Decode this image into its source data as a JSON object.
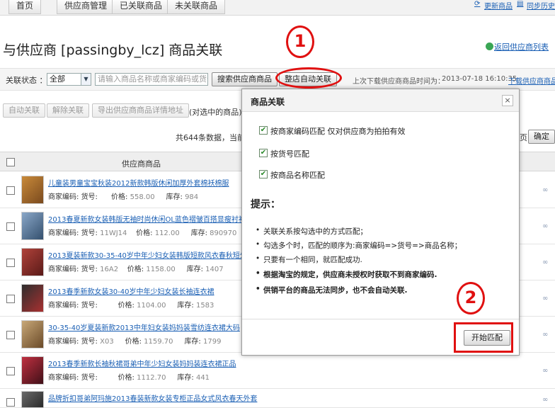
{
  "nav": {
    "tabs": [
      "首页",
      "供应商管理",
      "已关联商品",
      "未关联商品"
    ],
    "right_links": [
      "更新商品",
      "同步历史"
    ]
  },
  "page": {
    "title": "与供应商 [passingby_lcz] 商品关联",
    "back_link": "返回供应商列表"
  },
  "filter": {
    "status_label": "关联状态 ：",
    "status_value": "全部",
    "search_placeholder": "请输入商品名称或商家编码或货号",
    "search_button": "搜索供应商商品",
    "auto_link_button": "整店自动关联",
    "last_download_label": "上次下载供应商商品时间为：",
    "last_download_time": "2013-07-18 16:10:35",
    "download_link": "下载供应商商品"
  },
  "actions": {
    "auto_link": "自动关联",
    "unlink": "解除关联",
    "export": "导出供应商商品详情地址",
    "selected_note": "(对选中的商品)"
  },
  "pager": {
    "summary": "共644条数据，当前第",
    "page_suffix": "页",
    "confirm": "确定"
  },
  "table": {
    "header": "供应商商品",
    "meta_labels": {
      "code": "商家编码:",
      "sku": "货号:",
      "price": "价格:",
      "stock": "库存:"
    },
    "rows": [
      {
        "title": "儿童装男童宝宝秋装2012新款韩版休闲加厚外套棉袄棉服",
        "code": "",
        "sku": "",
        "price": "558.00",
        "stock": "984"
      },
      {
        "title": "2013春夏新款女装韩版无袖时尚休闲OL蓝色褶皱百搭显瘦衬衫",
        "code": "",
        "sku": "11WJ14",
        "price": "112.00",
        "stock": "890970"
      },
      {
        "title": "2013夏装新款30-35-40岁中年少妇女装韩版短款风衣春秋短外套",
        "code": "",
        "sku": "16A2",
        "price": "1158.00",
        "stock": "1407"
      },
      {
        "title": "2013春季新款女装30-40岁中年少妇女装长袖连衣裙",
        "code": "",
        "sku": "",
        "price": "1104.00",
        "stock": "1583"
      },
      {
        "title": "30-35-40岁夏装新款2013中年妇女装妈妈装雪纺连衣裙大码",
        "code": "",
        "sku": "X03",
        "price": "1159.70",
        "stock": "1799"
      },
      {
        "title": "2013春季新款长袖秋裙哥弟中年少妇女装妈妈装连衣裙正品",
        "code": "",
        "sku": "",
        "price": "1112.70",
        "stock": "441"
      },
      {
        "title": "品牌折扣哥弟阿玛施2013春装新款女装专柜正品女式风衣春天外套",
        "code": "",
        "sku": "",
        "price": "",
        "stock": ""
      }
    ]
  },
  "dialog": {
    "title": "商品关联",
    "close": "×",
    "options": [
      {
        "label": "按商家编码匹配 仅对供应商为拍拍有效",
        "checked": true
      },
      {
        "label": "按货号匹配",
        "checked": true
      },
      {
        "label": "按商品名称匹配",
        "checked": true
      }
    ],
    "tips_title": "提示：",
    "tips": [
      {
        "text": "关联关系按勾选中的方式匹配；",
        "bold": false
      },
      {
        "text": "勾选多个时，匹配的顺序为:商家编码=>货号=>商品名称；",
        "bold": false
      },
      {
        "text": "只要有一个相同，就匹配成功.",
        "bold": false
      },
      {
        "text": "根据淘宝的规定，供应商未授权时获取不到商家编码.",
        "bold": true
      },
      {
        "text": "供销平台的商品无法同步，也不会自动关联.",
        "bold": true
      }
    ],
    "start_button": "开始匹配"
  },
  "annotations": {
    "step1": "1",
    "step2": "2"
  },
  "colors": {
    "annotation": "#e01010",
    "link": "#1a5fb4"
  }
}
